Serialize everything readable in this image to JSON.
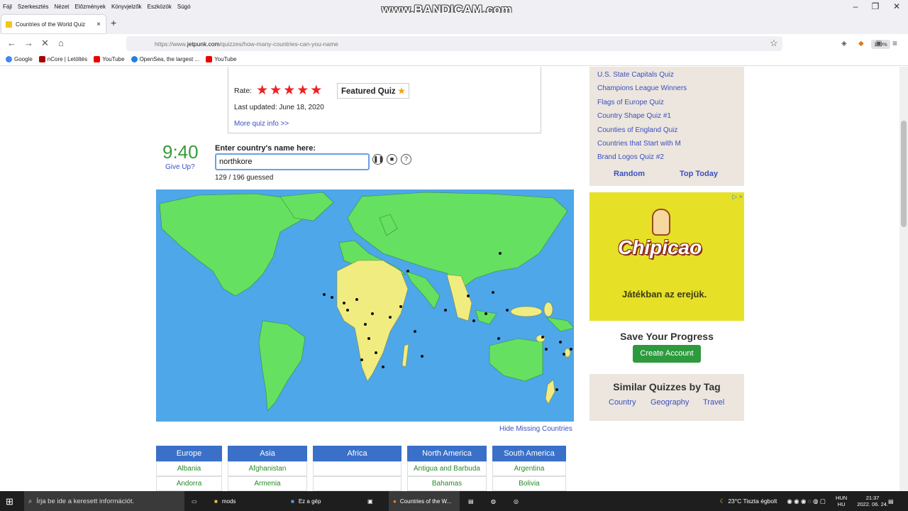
{
  "menu": [
    "Fájl",
    "Szerkesztés",
    "Nézet",
    "Előzmények",
    "Könyvjelzők",
    "Eszközök",
    "Súgó"
  ],
  "watermark": "www.BANDICAM.com",
  "tab": {
    "title": "Countries of the World Quiz",
    "close": "×"
  },
  "address": {
    "prefix": "https://www.",
    "domain": "jetpunk.com",
    "path": "/quizzes/how-many-countries-can-you-name",
    "zoom": "110%"
  },
  "bookmarks": [
    {
      "label": "Google",
      "color": "#4285f4"
    },
    {
      "label": "nCore | Letöltés",
      "color": "#a00"
    },
    {
      "label": "YouTube",
      "color": "#e00"
    },
    {
      "label": "OpenSea, the largest ...",
      "color": "#2081e2"
    },
    {
      "label": "YouTube",
      "color": "#e00"
    }
  ],
  "quizinfo": {
    "rate_label": "Rate:",
    "stars": 5,
    "featured": "Featured Quiz",
    "updated": "Last updated: June 18, 2020",
    "more_info": "More quiz info >>"
  },
  "game": {
    "timer": "9:40",
    "give_up": "Give Up?",
    "prompt": "Enter country's name here:",
    "input_value": "northkore",
    "guessed": "129 / 196 guessed",
    "hide_missing": "Hide Missing Countries"
  },
  "sidebar": {
    "links": [
      "U.S. State Capitals Quiz",
      "Champions League Winners",
      "Flags of Europe Quiz",
      "Country Shape Quiz #1",
      "Counties of England Quiz",
      "Countries that Start with M",
      "Brand Logos Quiz #2"
    ],
    "random": "Random",
    "top_today": "Top Today"
  },
  "ad": {
    "brand": "Chipicao",
    "tagline": "Játékban az erejük.",
    "close": "▷ ×"
  },
  "save": {
    "title": "Save Your Progress",
    "button": "Create Account"
  },
  "similar": {
    "title": "Similar Quizzes by Tag",
    "tags": [
      "Country",
      "Geography",
      "Travel"
    ]
  },
  "columns": [
    {
      "header": "Europe",
      "cells": [
        "Albania",
        "Andorra"
      ]
    },
    {
      "header": "Asia",
      "cells": [
        "Afghanistan",
        "Armenia"
      ]
    },
    {
      "header": "Africa",
      "cells": [
        "",
        ""
      ]
    },
    {
      "header": "North America",
      "cells": [
        "Antigua and Barbuda",
        "Bahamas"
      ]
    },
    {
      "header": "South America",
      "cells": [
        "Argentina",
        "Bolivia"
      ]
    }
  ],
  "taskbar": {
    "search": "Írja be ide a keresett információt.",
    "items": [
      "mods",
      "Ez a gép",
      "Countries of the W..."
    ],
    "weather": "23°C  Tiszta égbolt",
    "lang1": "HUN",
    "lang2": "HU",
    "time": "21:37",
    "date": "2022. 06. 24."
  },
  "colors": {
    "ocean": "#4da7e8",
    "land": "#66e060",
    "missing": "#f0ec80",
    "accent": "#3a70c8"
  }
}
